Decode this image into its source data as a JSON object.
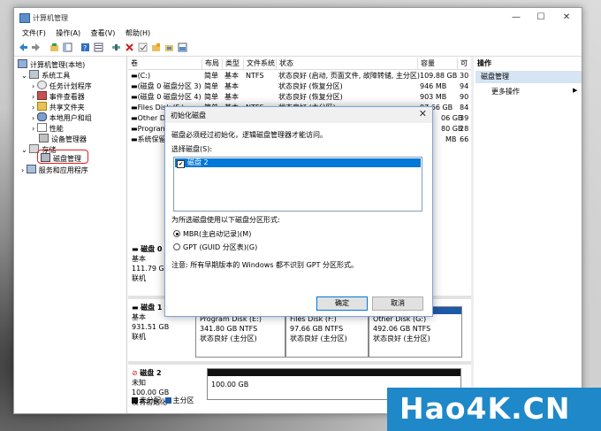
{
  "window": {
    "title": "计算机管理",
    "min": "—",
    "max": "☐",
    "close": "✕"
  },
  "menu": [
    "文件(F)",
    "操作(A)",
    "查看(V)",
    "帮助(H)"
  ],
  "tree": {
    "root": "计算机管理(本地)",
    "system_tools": "系统工具",
    "items": [
      "任务计划程序",
      "事件查看器",
      "共享文件夹",
      "本地用户和组",
      "性能",
      "设备管理器"
    ],
    "storage": "存储",
    "disk_mgmt": "磁盘管理",
    "services": "服务和应用程序"
  },
  "grid": {
    "headers": [
      "卷",
      "布局",
      "类型",
      "文件系统",
      "状态",
      "容量",
      "可"
    ],
    "rows": [
      [
        "(C:)",
        "简单",
        "基本",
        "NTFS",
        "状态良好 (启动, 页面文件, 故障转储, 主分区)",
        "109.88 GB",
        "30"
      ],
      [
        "(磁盘 0 磁盘分区 3)",
        "简单",
        "基本",
        "",
        "状态良好 (恢复分区)",
        "946 MB",
        "94"
      ],
      [
        "(磁盘 0 磁盘分区 4)",
        "简单",
        "基本",
        "",
        "状态良好 (恢复分区)",
        "903 MB",
        "90"
      ],
      [
        "Files Disk (F:)",
        "简单",
        "基本",
        "NTFS",
        "状态良好 (主分区)",
        "97.66 GB",
        "84"
      ],
      [
        "Other D",
        "",
        "",
        "",
        "",
        "06 GB",
        "39"
      ],
      [
        "Program",
        "",
        "",
        "",
        "",
        "80 GB",
        "28"
      ],
      [
        "系统保留",
        "",
        "",
        "",
        "",
        "MB",
        "66"
      ]
    ]
  },
  "actions": {
    "header": "操作",
    "section": "磁盘管理",
    "more": "更多操作"
  },
  "disks": [
    {
      "name": "磁盘 0",
      "type": "基本",
      "size": "111.79 GB",
      "status": "联机"
    },
    {
      "name": "磁盘 1",
      "type": "基本",
      "size": "931.51 GB",
      "status": "联机",
      "parts": [
        {
          "label": "Program Disk (E:)",
          "size": "341.80 GB NTFS",
          "status": "状态良好 (主分区)"
        },
        {
          "label": "Files Disk (F:)",
          "size": "97.66 GB NTFS",
          "status": "状态良好 (主分区)"
        },
        {
          "label": "Other Disk (G:)",
          "size": "492.06 GB NTFS",
          "status": "状态良好 (主分区)"
        }
      ]
    },
    {
      "name": "磁盘 2",
      "type": "未知",
      "size": "100.00 GB",
      "status": "没有初始化",
      "part_size": "100.00 GB"
    }
  ],
  "legend": [
    "未分配",
    "主分区"
  ],
  "dialog": {
    "title": "初始化磁盘",
    "close": "✕",
    "message": "磁盘必须经过初始化，逻辑磁盘管理器才能访问。",
    "select_label": "选择磁盘(S):",
    "disk_item": "磁盘 2",
    "style_label": "为所选磁盘使用以下磁盘分区形式:",
    "mbr": "MBR(主启动记录)(M)",
    "gpt": "GPT (GUID 分区表)(G)",
    "note": "注意: 所有早期版本的 Windows 都不识别 GPT 分区形式。",
    "ok": "确定",
    "cancel": "取消"
  },
  "watermark": "Hao4K.CN"
}
